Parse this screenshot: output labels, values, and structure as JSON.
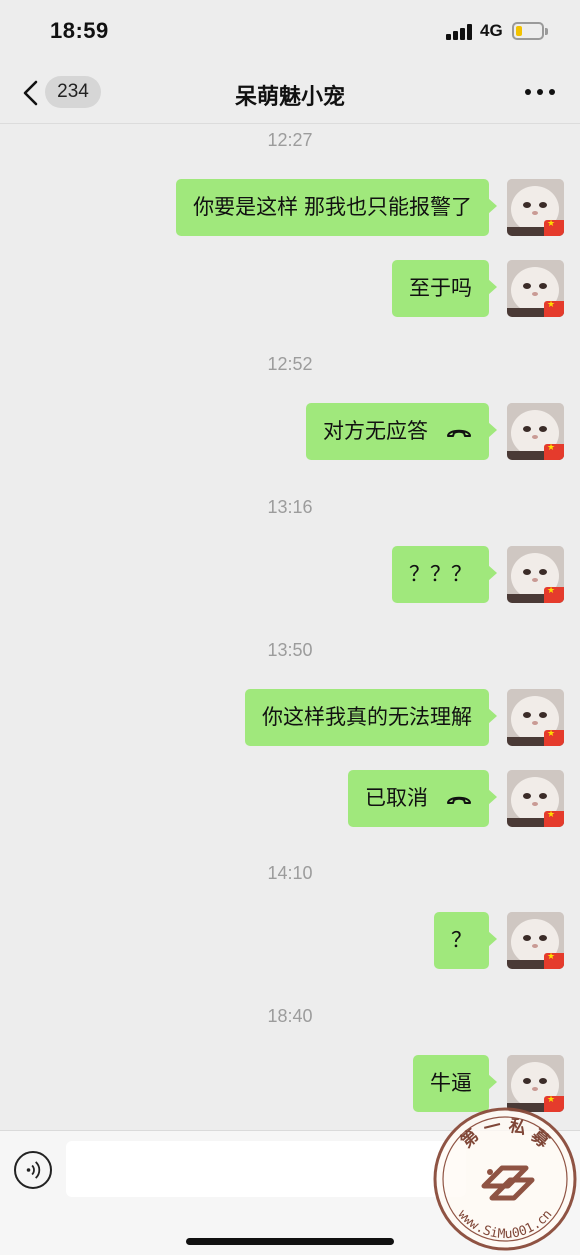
{
  "status_bar": {
    "time": "18:59",
    "network": "4G",
    "battery_fill_fraction": 0.25,
    "battery_color": "#f2c200"
  },
  "nav": {
    "back_icon": "chevron-left-icon",
    "unread_count": "234",
    "title": "呆萌魅小宠",
    "more_icon": "more-horizontal-icon"
  },
  "chat": {
    "bubble_color": "#a0e87c",
    "timestamp_color": "#9c9c9c",
    "timestamps": [
      {
        "text": "12:27"
      },
      {
        "text": "12:52"
      },
      {
        "text": "13:16"
      },
      {
        "text": "13:50"
      },
      {
        "text": "14:10"
      },
      {
        "text": "18:40"
      }
    ],
    "messages": [
      {
        "text": "你要是这样 那我也只能报警了",
        "sender": "self"
      },
      {
        "text": "至于吗",
        "sender": "self"
      },
      {
        "text": "对方无应答",
        "sender": "self",
        "icon": "hangup-phone-icon"
      },
      {
        "text": "？？？",
        "sender": "self"
      },
      {
        "text": "你这样我真的无法理解",
        "sender": "self"
      },
      {
        "text": "已取消",
        "sender": "self",
        "icon": "hangup-phone-icon"
      },
      {
        "text": "？",
        "sender": "self"
      },
      {
        "text": "牛逼",
        "sender": "self"
      }
    ]
  },
  "input_bar": {
    "voice_icon": "voice-input-icon",
    "placeholder": ""
  },
  "watermark": {
    "text": "第 一 私 募  www.SiMu001.cn"
  }
}
